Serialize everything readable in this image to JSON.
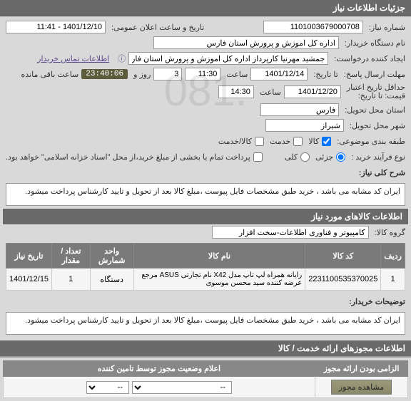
{
  "header": {
    "title": "جزئیات اطلاعات نیاز"
  },
  "fields": {
    "need_no_label": "شماره نیاز:",
    "need_no": "1101003679000708",
    "announce_label": "تاریخ و ساعت اعلان عمومی:",
    "announce_val": "1401/12/10 - 11:41",
    "buyer_org_label": "نام دستگاه خریدار:",
    "buyer_org": "اداره کل اموزش و پرورش استان فارس",
    "creator_label": "ایجاد کننده درخواست:",
    "creator": "جمشید مهرنیا کارپرداز اداره کل اموزش و پرورش استان فارس",
    "contact": "اطلاعات تماس خریدار",
    "send_deadline_label": "مهلت ارسال پاسخ:",
    "send_deadline_time_label": "تا تاریخ:",
    "send_date": "1401/12/14",
    "time_label": "ساعت",
    "send_time": "11:30",
    "day_label": "روز و",
    "days": "3",
    "remain_label": "ساعت باقی مانده",
    "countdown": "23:40:06",
    "min_valid_label": "حداقل تاریخ اعتبار",
    "min_valid_label2": "قیمت: تا تاریخ:",
    "valid_date": "1401/12/20",
    "valid_time": "14:30",
    "exec_prov_label": "استان محل تحویل:",
    "exec_prov": "فارس",
    "exec_city_label": "شهر محل تحویل:",
    "exec_city": "شیراز",
    "class_label": "طبقه بندی موضوعی:",
    "proc_type_label": "نوع فرآیند خرید :",
    "goods": "کالا",
    "service": "خدمت",
    "goods_service": "کالا/خدمت",
    "partial": "جزئی",
    "total": "کلی",
    "pay_note": "پرداخت تمام یا بخشی از مبلغ خرید،از محل \"اسناد خزانه اسلامی\" خواهد بود."
  },
  "desc": {
    "title": "شرح کلی نیاز:",
    "text": "ایران کد مشابه می باشد ، خرید طبق مشخصات فایل پیوست ،مبلغ کالا بعد از تحویل و تایید کارشناس پرداخت میشود."
  },
  "items": {
    "title": "اطلاعات کالاهای مورد نیاز",
    "group_label": "گروه کالا:",
    "group_val": "کامپیوتر و فناوری اطلاعات-سخت افزار",
    "headers": {
      "row": "ردیف",
      "code": "کد کالا",
      "name": "نام کالا",
      "unit": "واحد شمارش",
      "qty": "تعداد / مقدار",
      "date": "تاریخ نیاز"
    },
    "rows": [
      {
        "idx": "1",
        "code": "2231100535370025",
        "name": "رایانه همراه لپ تاپ مدل X42 نام تجارتی ASUS مرجع عرضه کننده سید محسن موسوی",
        "unit": "دستگاه",
        "qty": "1",
        "date": "1401/12/15"
      }
    ]
  },
  "buyer_note": {
    "label": "توضیحات خریدار:",
    "text": "ایران کد مشابه می باشد ، خرید طبق مشخصات فایل پیوست ،مبلغ کالا بعد از تحویل و تایید کارشناس پرداخت میشود."
  },
  "licenses": {
    "title": "اطلاعات مجوزهای ارائه خدمت / کالا"
  },
  "status": {
    "mandatory_label": "الزامی بودن ارائه مجوز",
    "declare_label": "اعلام وضعیت مجوز توسط تامین کننده",
    "select_default": "--",
    "view_btn": "مشاهده مجوز"
  }
}
